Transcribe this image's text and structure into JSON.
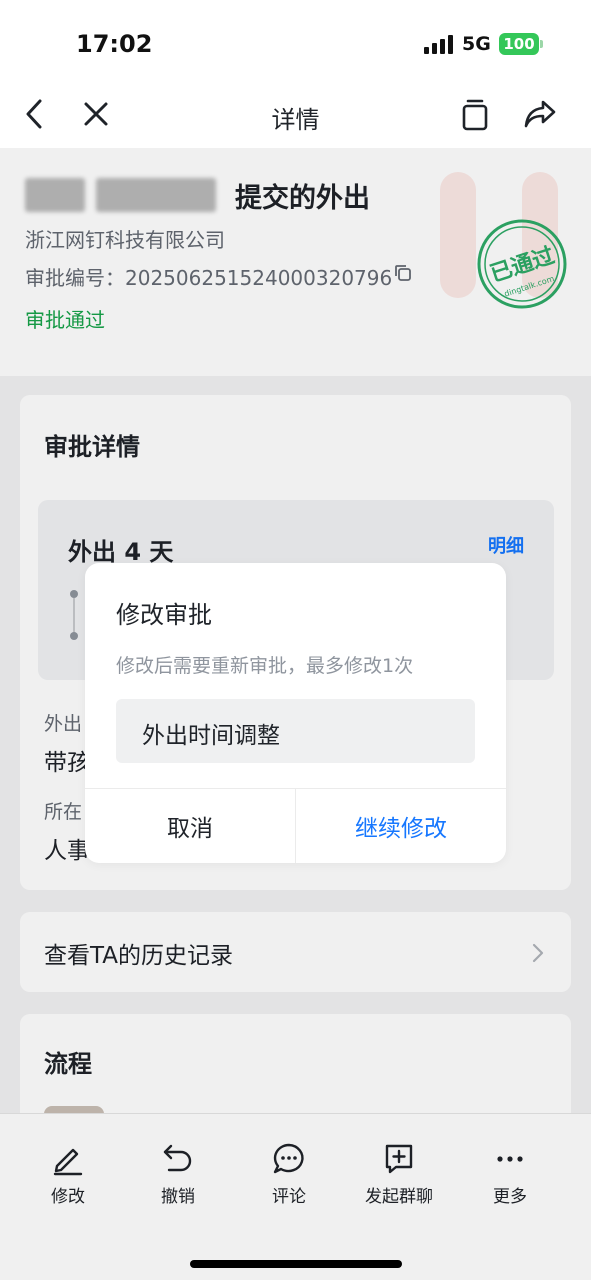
{
  "status_bar": {
    "time": "17:02",
    "network": "5G",
    "battery": "100"
  },
  "nav": {
    "title": "详情"
  },
  "header": {
    "submit_title": "提交的外出",
    "company": "浙江网钉科技有限公司",
    "approval_no": "审批编号：20250625152400032079​6",
    "status": "审批通过",
    "stamp_text": "已通过",
    "stamp_domain": "dingtalk.com"
  },
  "details_card": {
    "title": "审批详情",
    "outing": "外出 4 天",
    "detail_link": "明细",
    "field1_label": "外出",
    "field1_value": "带孩",
    "field2_label": "所在",
    "field2_value": "人事"
  },
  "history": {
    "label": "查看TA的历史记录"
  },
  "process": {
    "title": "流程"
  },
  "toolbar": [
    {
      "label": "修改",
      "icon": "pencil-icon"
    },
    {
      "label": "撤销",
      "icon": "undo-icon"
    },
    {
      "label": "评论",
      "icon": "comment-icon"
    },
    {
      "label": "发起群聊",
      "icon": "group-chat-icon"
    },
    {
      "label": "更多",
      "icon": "more-icon"
    }
  ],
  "dialog": {
    "title": "修改审批",
    "description": "修改后需要重新审批，最多修改1次",
    "option": "外出时间调整",
    "cancel": "取消",
    "continue": "继续修改"
  },
  "colors": {
    "accent": "#1677ff",
    "approved": "#17a34a",
    "stamp": "#2eaa68"
  }
}
